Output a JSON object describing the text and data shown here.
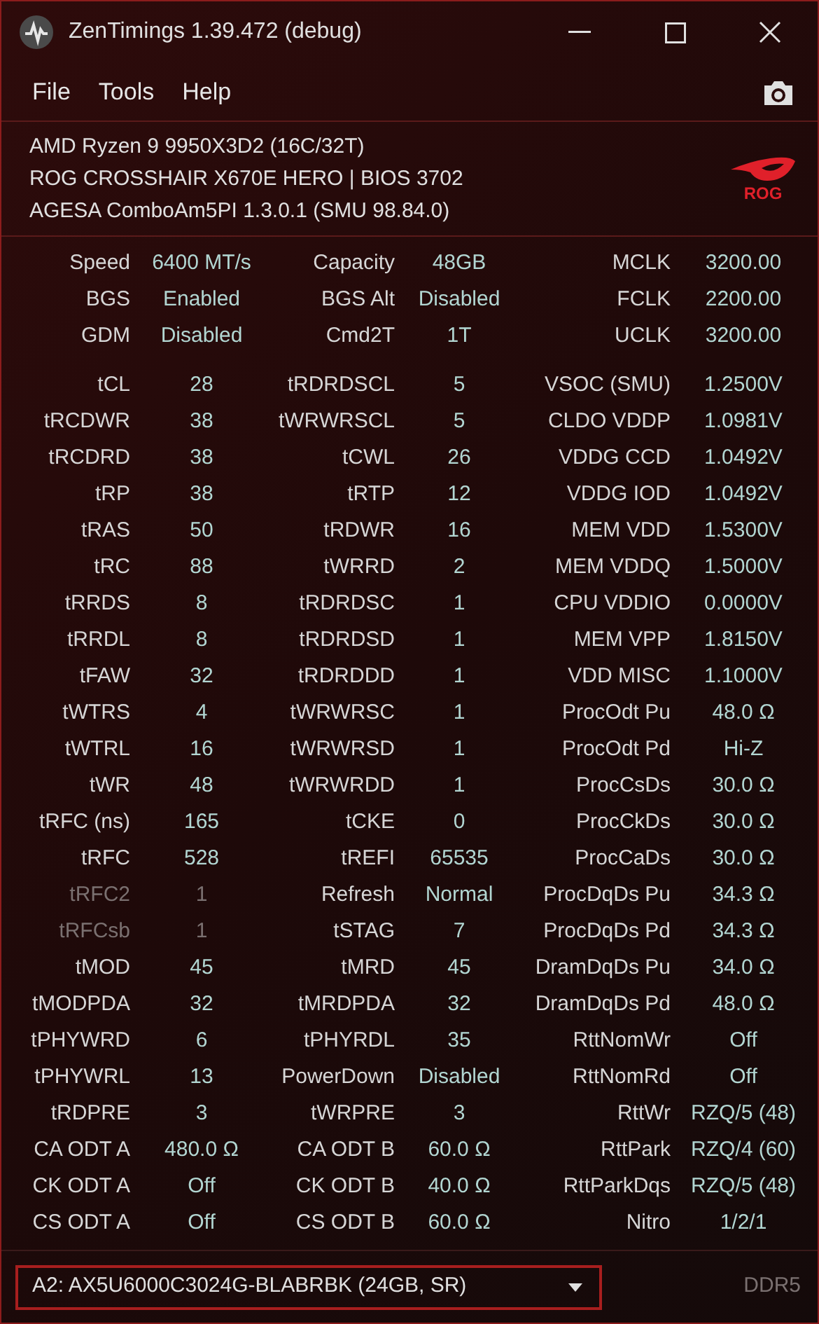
{
  "window": {
    "title": "ZenTimings 1.39.472 (debug)"
  },
  "menu": [
    "File",
    "Tools",
    "Help"
  ],
  "system_info": [
    "AMD Ryzen 9 9950X3D2 (16C/32T)",
    "ROG CROSSHAIR X670E HERO | BIOS 3702",
    "AGESA ComboAm5PI 1.3.0.1 (SMU 98.84.0)"
  ],
  "logo_text": "ROG",
  "summary": [
    [
      {
        "label": "Speed",
        "value": "6400 MT/s",
        "disabled": false
      },
      {
        "label": "Capacity",
        "value": "48GB",
        "disabled": false
      },
      {
        "label": "MCLK",
        "value": "3200.00",
        "disabled": false
      }
    ],
    [
      {
        "label": "BGS",
        "value": "Enabled",
        "disabled": false
      },
      {
        "label": "BGS Alt",
        "value": "Disabled",
        "disabled": false
      },
      {
        "label": "FCLK",
        "value": "2200.00",
        "disabled": false
      }
    ],
    [
      {
        "label": "GDM",
        "value": "Disabled",
        "disabled": false
      },
      {
        "label": "Cmd2T",
        "value": "1T",
        "disabled": false
      },
      {
        "label": "UCLK",
        "value": "3200.00",
        "disabled": false
      }
    ]
  ],
  "timings": [
    [
      {
        "label": "tCL",
        "value": "28",
        "disabled": false
      },
      {
        "label": "tRDRDSCL",
        "value": "5",
        "disabled": false
      },
      {
        "label": "VSOC (SMU)",
        "value": "1.2500V",
        "disabled": false
      }
    ],
    [
      {
        "label": "tRCDWR",
        "value": "38",
        "disabled": false
      },
      {
        "label": "tWRWRSCL",
        "value": "5",
        "disabled": false
      },
      {
        "label": "CLDO VDDP",
        "value": "1.0981V",
        "disabled": false
      }
    ],
    [
      {
        "label": "tRCDRD",
        "value": "38",
        "disabled": false
      },
      {
        "label": "tCWL",
        "value": "26",
        "disabled": false
      },
      {
        "label": "VDDG CCD",
        "value": "1.0492V",
        "disabled": false
      }
    ],
    [
      {
        "label": "tRP",
        "value": "38",
        "disabled": false
      },
      {
        "label": "tRTP",
        "value": "12",
        "disabled": false
      },
      {
        "label": "VDDG IOD",
        "value": "1.0492V",
        "disabled": false
      }
    ],
    [
      {
        "label": "tRAS",
        "value": "50",
        "disabled": false
      },
      {
        "label": "tRDWR",
        "value": "16",
        "disabled": false
      },
      {
        "label": "MEM VDD",
        "value": "1.5300V",
        "disabled": false
      }
    ],
    [
      {
        "label": "tRC",
        "value": "88",
        "disabled": false
      },
      {
        "label": "tWRRD",
        "value": "2",
        "disabled": false
      },
      {
        "label": "MEM VDDQ",
        "value": "1.5000V",
        "disabled": false
      }
    ],
    [
      {
        "label": "tRRDS",
        "value": "8",
        "disabled": false
      },
      {
        "label": "tRDRDSC",
        "value": "1",
        "disabled": false
      },
      {
        "label": "CPU VDDIO",
        "value": "0.0000V",
        "disabled": false
      }
    ],
    [
      {
        "label": "tRRDL",
        "value": "8",
        "disabled": false
      },
      {
        "label": "tRDRDSD",
        "value": "1",
        "disabled": false
      },
      {
        "label": "MEM VPP",
        "value": "1.8150V",
        "disabled": false
      }
    ],
    [
      {
        "label": "tFAW",
        "value": "32",
        "disabled": false
      },
      {
        "label": "tRDRDDD",
        "value": "1",
        "disabled": false
      },
      {
        "label": "VDD MISC",
        "value": "1.1000V",
        "disabled": false
      }
    ],
    [
      {
        "label": "tWTRS",
        "value": "4",
        "disabled": false
      },
      {
        "label": "tWRWRSC",
        "value": "1",
        "disabled": false
      },
      {
        "label": "ProcOdt Pu",
        "value": "48.0 Ω",
        "disabled": false
      }
    ],
    [
      {
        "label": "tWTRL",
        "value": "16",
        "disabled": false
      },
      {
        "label": "tWRWRSD",
        "value": "1",
        "disabled": false
      },
      {
        "label": "ProcOdt Pd",
        "value": "Hi-Z",
        "disabled": false
      }
    ],
    [
      {
        "label": "tWR",
        "value": "48",
        "disabled": false
      },
      {
        "label": "tWRWRDD",
        "value": "1",
        "disabled": false
      },
      {
        "label": "ProcCsDs",
        "value": "30.0 Ω",
        "disabled": false
      }
    ],
    [
      {
        "label": "tRFC (ns)",
        "value": "165",
        "disabled": false
      },
      {
        "label": "tCKE",
        "value": "0",
        "disabled": false
      },
      {
        "label": "ProcCkDs",
        "value": "30.0 Ω",
        "disabled": false
      }
    ],
    [
      {
        "label": "tRFC",
        "value": "528",
        "disabled": false
      },
      {
        "label": "tREFI",
        "value": "65535",
        "disabled": false
      },
      {
        "label": "ProcCaDs",
        "value": "30.0 Ω",
        "disabled": false
      }
    ],
    [
      {
        "label": "tRFC2",
        "value": "1",
        "disabled": true
      },
      {
        "label": "Refresh",
        "value": "Normal",
        "disabled": false
      },
      {
        "label": "ProcDqDs Pu",
        "value": "34.3 Ω",
        "disabled": false
      }
    ],
    [
      {
        "label": "tRFCsb",
        "value": "1",
        "disabled": true
      },
      {
        "label": "tSTAG",
        "value": "7",
        "disabled": false
      },
      {
        "label": "ProcDqDs Pd",
        "value": "34.3 Ω",
        "disabled": false
      }
    ],
    [
      {
        "label": "tMOD",
        "value": "45",
        "disabled": false
      },
      {
        "label": "tMRD",
        "value": "45",
        "disabled": false
      },
      {
        "label": "DramDqDs Pu",
        "value": "34.0 Ω",
        "disabled": false
      }
    ],
    [
      {
        "label": "tMODPDA",
        "value": "32",
        "disabled": false
      },
      {
        "label": "tMRDPDA",
        "value": "32",
        "disabled": false
      },
      {
        "label": "DramDqDs Pd",
        "value": "48.0 Ω",
        "disabled": false
      }
    ],
    [
      {
        "label": "tPHYWRD",
        "value": "6",
        "disabled": false
      },
      {
        "label": "tPHYRDL",
        "value": "35",
        "disabled": false
      },
      {
        "label": "RttNomWr",
        "value": "Off",
        "disabled": false
      }
    ],
    [
      {
        "label": "tPHYWRL",
        "value": "13",
        "disabled": false
      },
      {
        "label": "PowerDown",
        "value": "Disabled",
        "disabled": false
      },
      {
        "label": "RttNomRd",
        "value": "Off",
        "disabled": false
      }
    ],
    [
      {
        "label": "tRDPRE",
        "value": "3",
        "disabled": false
      },
      {
        "label": "tWRPRE",
        "value": "3",
        "disabled": false
      },
      {
        "label": "RttWr",
        "value": "RZQ/5 (48)",
        "disabled": false
      }
    ],
    [
      {
        "label": "CA ODT A",
        "value": "480.0 Ω",
        "disabled": false
      },
      {
        "label": "CA ODT B",
        "value": "60.0 Ω",
        "disabled": false
      },
      {
        "label": "RttPark",
        "value": "RZQ/4 (60)",
        "disabled": false
      }
    ],
    [
      {
        "label": "CK ODT A",
        "value": "Off",
        "disabled": false
      },
      {
        "label": "CK ODT B",
        "value": "40.0 Ω",
        "disabled": false
      },
      {
        "label": "RttParkDqs",
        "value": "RZQ/5 (48)",
        "disabled": false
      }
    ],
    [
      {
        "label": "CS ODT A",
        "value": "Off",
        "disabled": false
      },
      {
        "label": "CS ODT B",
        "value": "60.0 Ω",
        "disabled": false
      },
      {
        "label": "Nitro",
        "value": "1/2/1",
        "disabled": false
      }
    ]
  ],
  "module_select": {
    "value": "A2: AX5U6000C3024G-BLABRBK (24GB, SR)"
  },
  "memory_type": "DDR5"
}
